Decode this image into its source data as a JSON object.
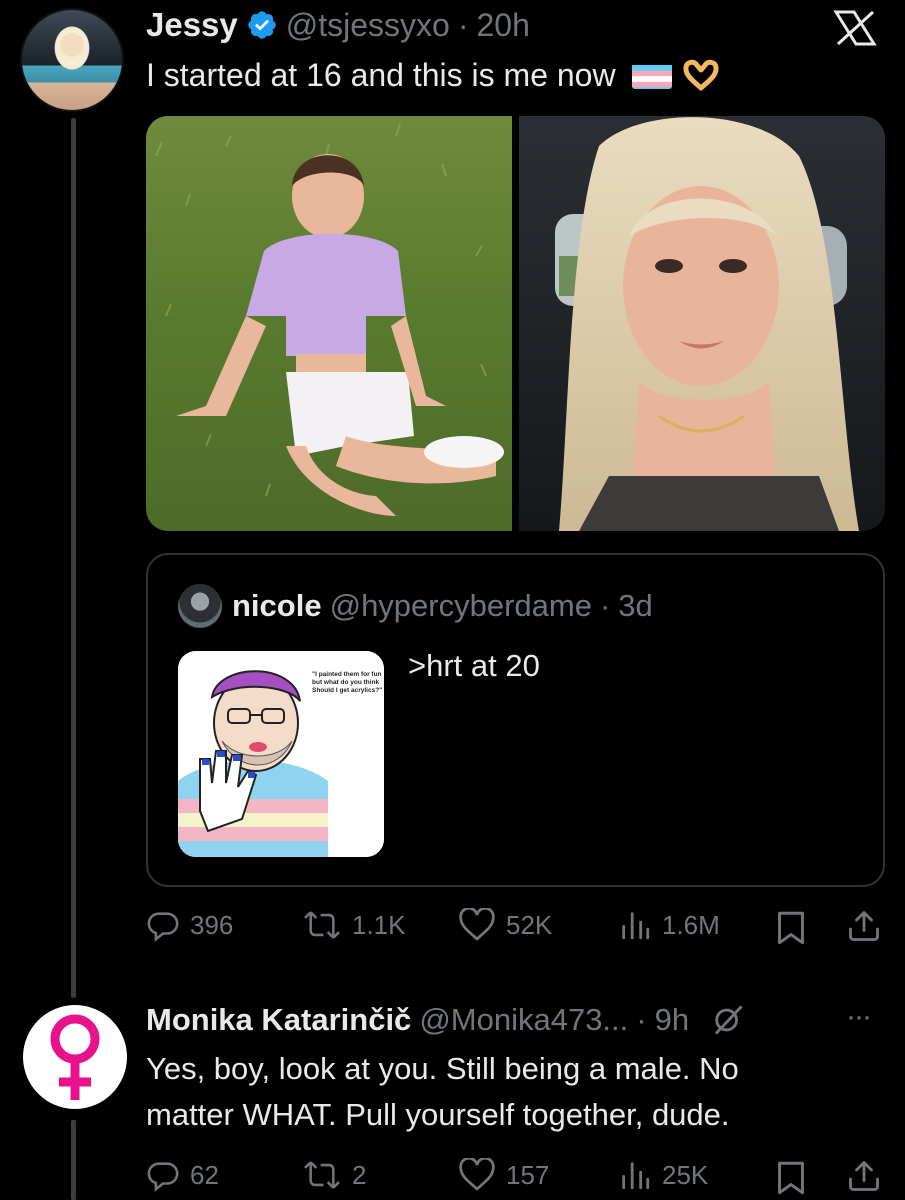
{
  "tweet": {
    "author_name": "Jessy",
    "verified_icon": "verified-badge-icon",
    "handle": "@tsjessyxo",
    "separator": "·",
    "time": "20h",
    "text": "I started at 16 and this is me now",
    "emoji_flag": "transgender-flag",
    "emoji_heart_hands": "heart-hands",
    "actions": {
      "replies": "396",
      "retweets": "1.1K",
      "likes": "52K",
      "views": "1.6M"
    }
  },
  "quote": {
    "author_name": "nicole",
    "handle": "@hypercyberdame",
    "separator": "·",
    "time": "3d",
    "text": ">hrt at 20",
    "image_caption": "\"I painted them for fun but what do you think Should I get acrylics?\""
  },
  "reply": {
    "author_name": "Monika Katarinčič",
    "handle": "@Monika473...",
    "separator": "·",
    "time": "9h",
    "text_line1": "Yes, boy, look at you. Still being a male. No",
    "text_line2": "matter WHAT. Pull yourself together, dude.",
    "more_label": "···",
    "actions": {
      "replies": "62",
      "retweets": "2",
      "likes": "157",
      "views": "25K"
    }
  },
  "colors": {
    "background": "#000000",
    "text": "#e7e9ea",
    "muted": "#71767b",
    "verified": "#1d9bf0",
    "venus": "#e8128c"
  }
}
